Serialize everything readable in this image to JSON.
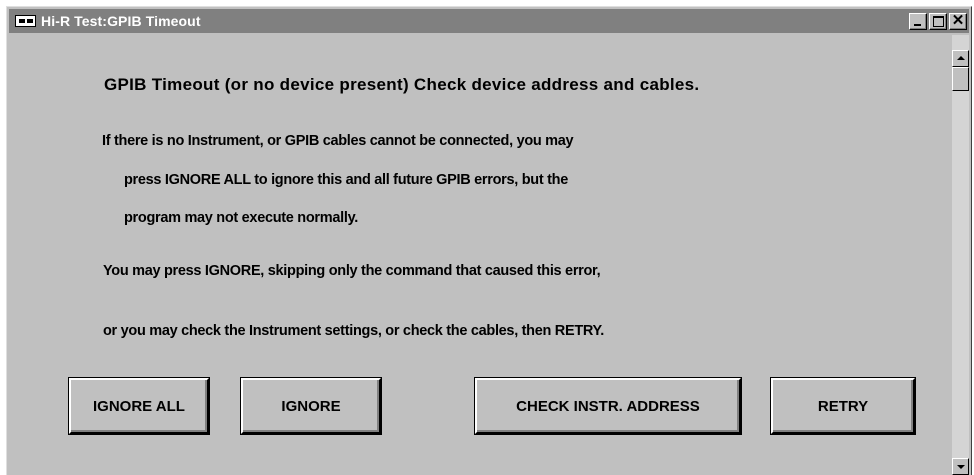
{
  "window": {
    "title": "Hi-R Test:GPIB Timeout",
    "icon": "app-system-icon",
    "controls": {
      "minimize_icon": "minimize-icon",
      "maximize_icon": "maximize-icon",
      "close_label": "✕"
    }
  },
  "message": {
    "headline": "GPIB Timeout (or no device present) Check device address and cables.",
    "line1": "If there is no Instrument, or GPIB cables cannot be connected, you may",
    "line2": "press IGNORE ALL to ignore this and all future GPIB errors, but the",
    "line3": "program may not execute normally.",
    "line4": "You may press IGNORE, skipping only the command that caused this error,",
    "line5": "or you may check the Instrument settings, or check the cables, then RETRY."
  },
  "buttons": {
    "ignore_all": "IGNORE ALL",
    "ignore": "IGNORE",
    "check_address": "CHECK INSTR. ADDRESS",
    "retry": "RETRY"
  },
  "colors": {
    "face": "#c0c0c0",
    "titlebar_inactive": "#808080"
  }
}
